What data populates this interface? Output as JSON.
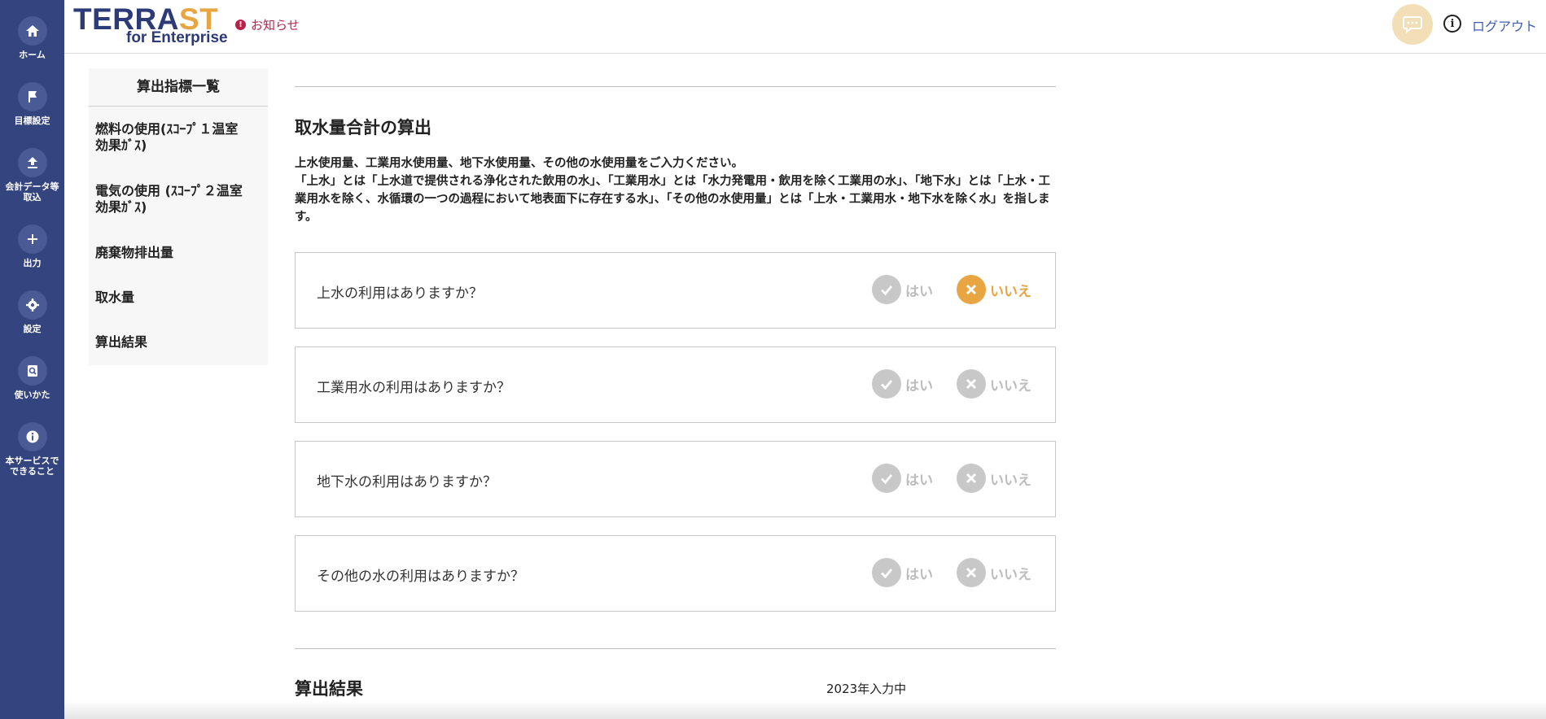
{
  "nav": {
    "items": [
      {
        "label": "ホーム",
        "icon": "home-icon"
      },
      {
        "label": "目標設定",
        "icon": "flag-icon"
      },
      {
        "label": "会計データ等\n取込",
        "icon": "upload-icon"
      },
      {
        "label": "出力",
        "icon": "plus-icon"
      },
      {
        "label": "設定",
        "icon": "gear-icon"
      },
      {
        "label": "使いかた",
        "icon": "guide-search-icon"
      },
      {
        "label": "本サービスで\nできること",
        "icon": "info-icon"
      }
    ]
  },
  "header": {
    "logo_main_a": "TERRA",
    "logo_main_b": "ST",
    "logo_sub": "for Enterprise",
    "notice_label": "お知らせ",
    "logout_label": "ログアウト"
  },
  "side_index": {
    "title": "算出指標一覧",
    "items": [
      "燃料の使用(ｽｺｰﾌﾟ１温室\n効果ｶﾞｽ)",
      "電気の使用 (ｽｺｰﾌﾟ２温室\n効果ｶﾞｽ)",
      "廃棄物排出量",
      "取水量",
      "算出結果"
    ]
  },
  "main": {
    "section_title": "取水量合計の算出",
    "description_line1": "上水使用量、工業用水使用量、地下水使用量、その他の水使用量をご入力ください。",
    "description_line2": "「上水」とは「上水道で提供される浄化された飲用の水」、「工業用水」とは「水力発電用・飲用を除く工業用の水」、「地下水」とは「上水・工業用水を除く、水循環の一つの過程において地表面下に存在する水」、「その他の水使用量」とは「上水・工業用水・地下水を除く水」を指します。",
    "yes_label": "はい",
    "no_label": "いいえ",
    "questions": [
      {
        "text": "上水の利用はありますか？",
        "selected": "no"
      },
      {
        "text": "工業用水の利用はありますか？",
        "selected": "none"
      },
      {
        "text": "地下水の利用はありますか？",
        "selected": "none"
      },
      {
        "text": "その他の水の利用はありますか？",
        "selected": "none"
      }
    ],
    "result_title": "算出結果",
    "year_label": "2023年入力中"
  },
  "colors": {
    "nav_bg": "#34447e",
    "accent_orange": "#e8a541",
    "notice_red": "#b62249",
    "link_blue": "#3e5fb0",
    "inactive_gray": "#c8c8c8"
  }
}
